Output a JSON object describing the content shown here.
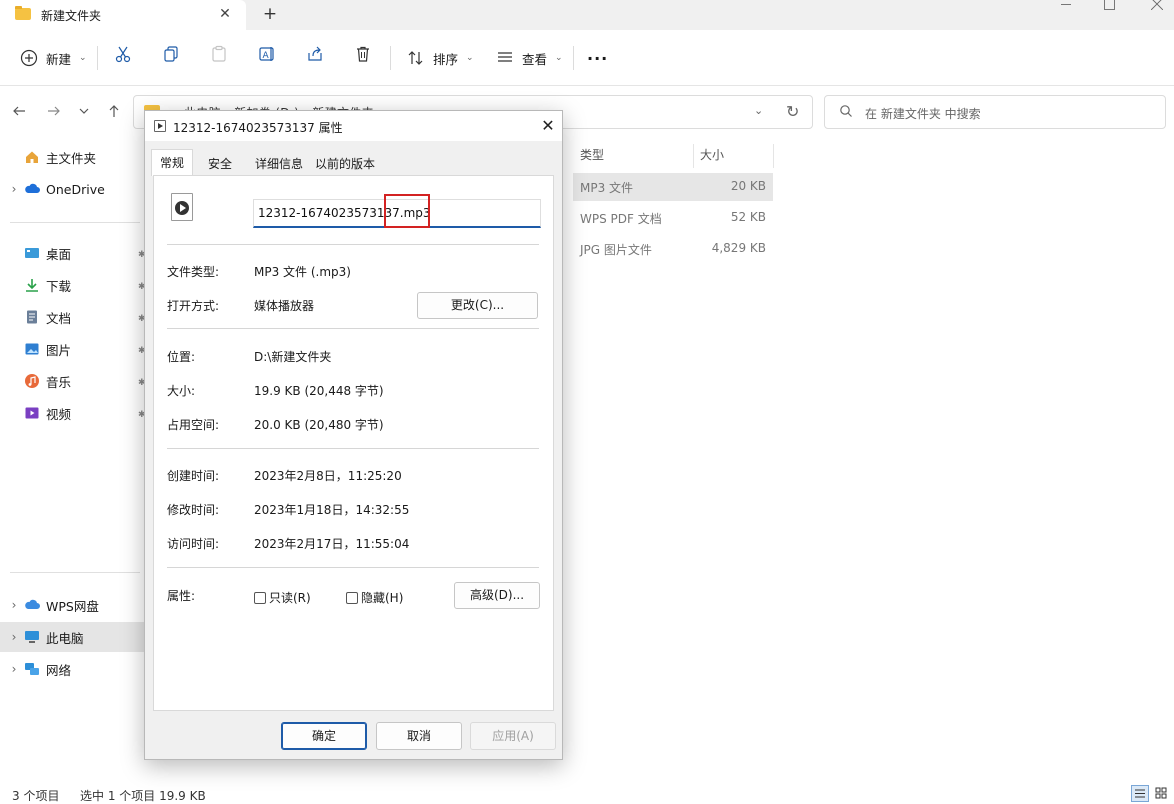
{
  "explorer": {
    "tab_title": "新建文件夹",
    "tab_close": "✕",
    "new_tab": "+",
    "toolbar": {
      "new_label": "新建",
      "sort_label": "排序",
      "view_label": "查看",
      "more_label": "···"
    },
    "address": {
      "path": "此电脑  ›  新加卷 (D:)  ›  新建文件夹"
    },
    "search_placeholder": "在 新建文件夹 中搜索",
    "sidebar": {
      "items": [
        {
          "label": "主文件夹",
          "icon": "home-icon"
        },
        {
          "label": "OneDrive",
          "icon": "cloud-icon"
        },
        {
          "label": "桌面",
          "icon": "desktop-icon"
        },
        {
          "label": "下载",
          "icon": "download-icon"
        },
        {
          "label": "文档",
          "icon": "document-icon"
        },
        {
          "label": "图片",
          "icon": "picture-icon"
        },
        {
          "label": "音乐",
          "icon": "music-icon"
        },
        {
          "label": "视频",
          "icon": "video-icon"
        },
        {
          "label": "WPS网盘",
          "icon": "cloud-icon"
        },
        {
          "label": "此电脑",
          "icon": "computer-icon"
        },
        {
          "label": "网络",
          "icon": "network-icon"
        }
      ]
    },
    "columns": {
      "type": "类型",
      "size": "大小"
    },
    "files": [
      {
        "type": "MP3 文件",
        "size": "20 KB"
      },
      {
        "type": "WPS PDF 文档",
        "size": "52 KB"
      },
      {
        "type": "JPG 图片文件",
        "size": "4,829 KB"
      }
    ],
    "status": {
      "count": "3 个项目",
      "selection": "选中 1 个项目  19.9 KB"
    }
  },
  "dialog": {
    "title": "12312-1674023573137 属性",
    "close": "✕",
    "tabs": [
      "常规",
      "安全",
      "详细信息",
      "以前的版本"
    ],
    "filename": "12312-1674023573137.mp3",
    "rows": {
      "file_type_label": "文件类型:",
      "file_type_value": "MP3 文件 (.mp3)",
      "open_with_label": "打开方式:",
      "open_with_value": "媒体播放器",
      "change_button": "更改(C)...",
      "location_label": "位置:",
      "location_value": "D:\\新建文件夹",
      "size_label": "大小:",
      "size_value": "19.9 KB (20,448 字节)",
      "disk_size_label": "占用空间:",
      "disk_size_value": "20.0 KB (20,480 字节)",
      "created_label": "创建时间:",
      "created_value": "2023年2月8日，11:25:20",
      "modified_label": "修改时间:",
      "modified_value": "2023年1月18日，14:32:55",
      "accessed_label": "访问时间:",
      "accessed_value": "2023年2月17日，11:55:04",
      "attributes_label": "属性:",
      "readonly_label": "只读(R)",
      "hidden_label": "隐藏(H)",
      "advanced_button": "高级(D)..."
    },
    "buttons": {
      "ok": "确定",
      "cancel": "取消",
      "apply": "应用(A)"
    }
  }
}
